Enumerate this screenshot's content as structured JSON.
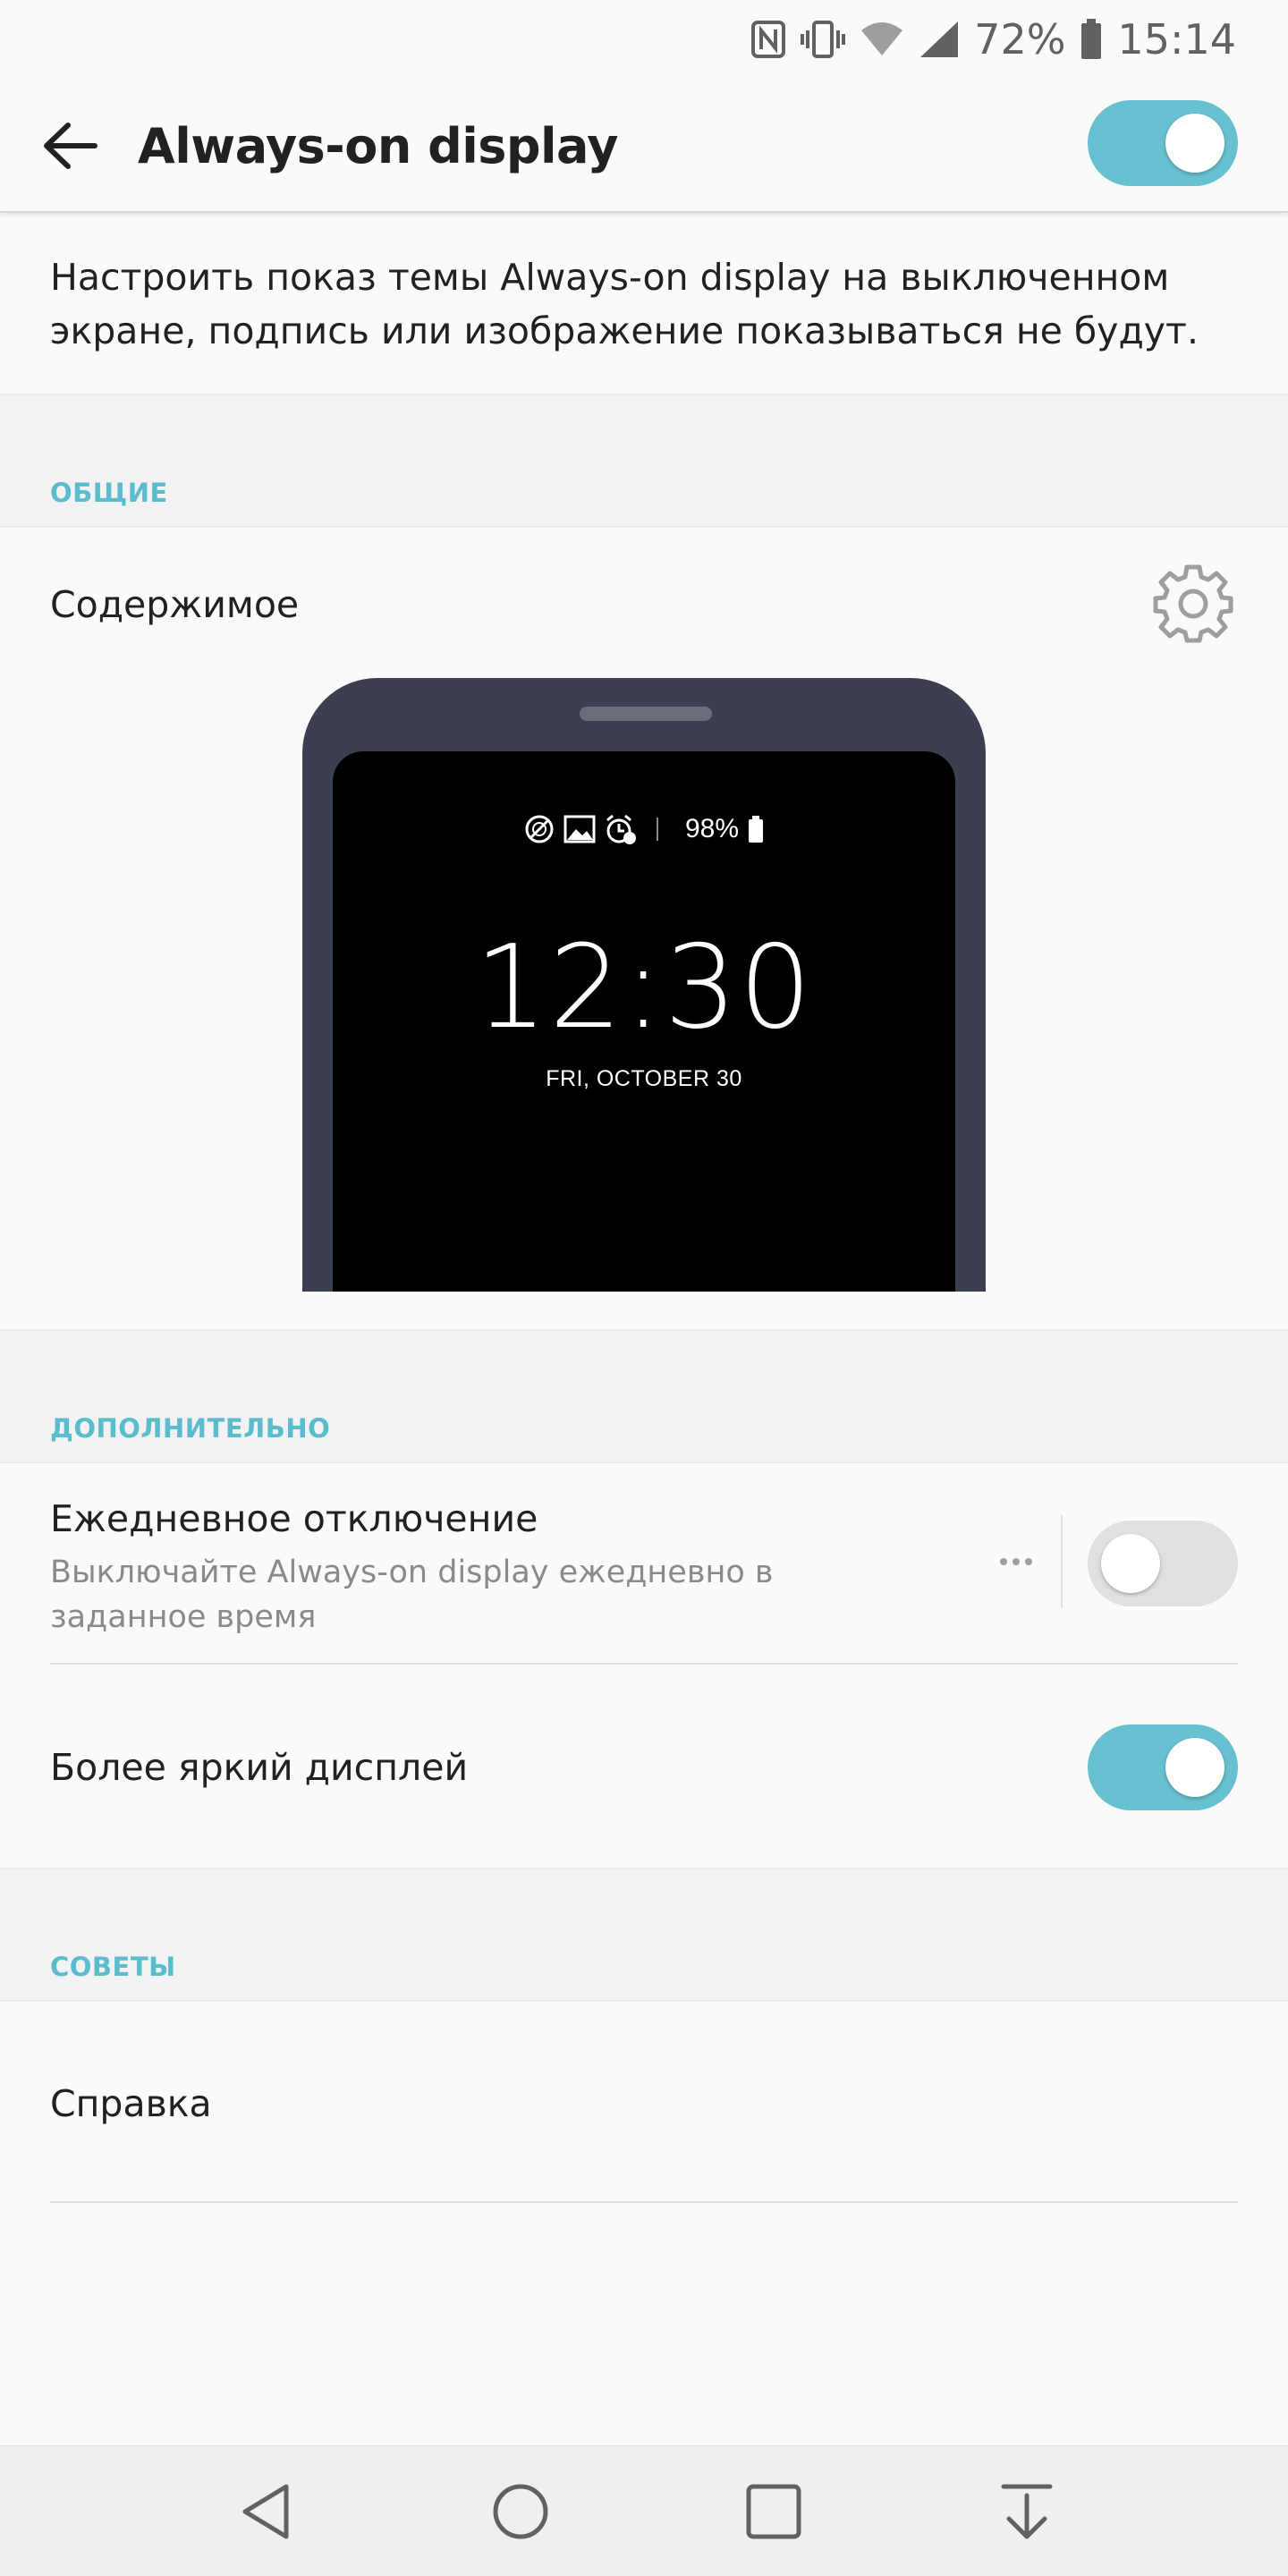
{
  "status_bar": {
    "battery_percent": "72%",
    "time": "15:14",
    "icons": [
      "nfc-icon",
      "vibrate-icon",
      "wifi-icon",
      "signal-icon",
      "battery-icon"
    ]
  },
  "app_bar": {
    "title": "Always-on display",
    "master_toggle_on": true
  },
  "description": "Настроить показ темы Always-on display на выключенном экране, подпись или изображение показываться не будут.",
  "sections": {
    "general": {
      "header": "ОБЩИЕ",
      "content_label": "Содержимое"
    },
    "additional": {
      "header": "ДОПОЛНИТЕЛЬНО",
      "daily_off": {
        "title": "Ежедневное отключение",
        "subtitle": "Выключайте Always-on display ежедневно в заданное время",
        "toggle_on": false
      },
      "brighter_display": {
        "title": "Более яркий дисплей",
        "toggle_on": true
      }
    },
    "tips": {
      "header": "СОВЕТЫ",
      "help_label": "Справка"
    }
  },
  "preview": {
    "battery": "98%",
    "time": "12:30",
    "date": "FRI, OCTOBER 30"
  },
  "colors": {
    "accent": "#68c1d0",
    "section_header": "#5bbccd",
    "phone_body": "#3c3f50"
  },
  "nav_bar": {
    "buttons": [
      "back-icon",
      "home-icon",
      "recents-icon",
      "notification-pull-icon"
    ]
  }
}
